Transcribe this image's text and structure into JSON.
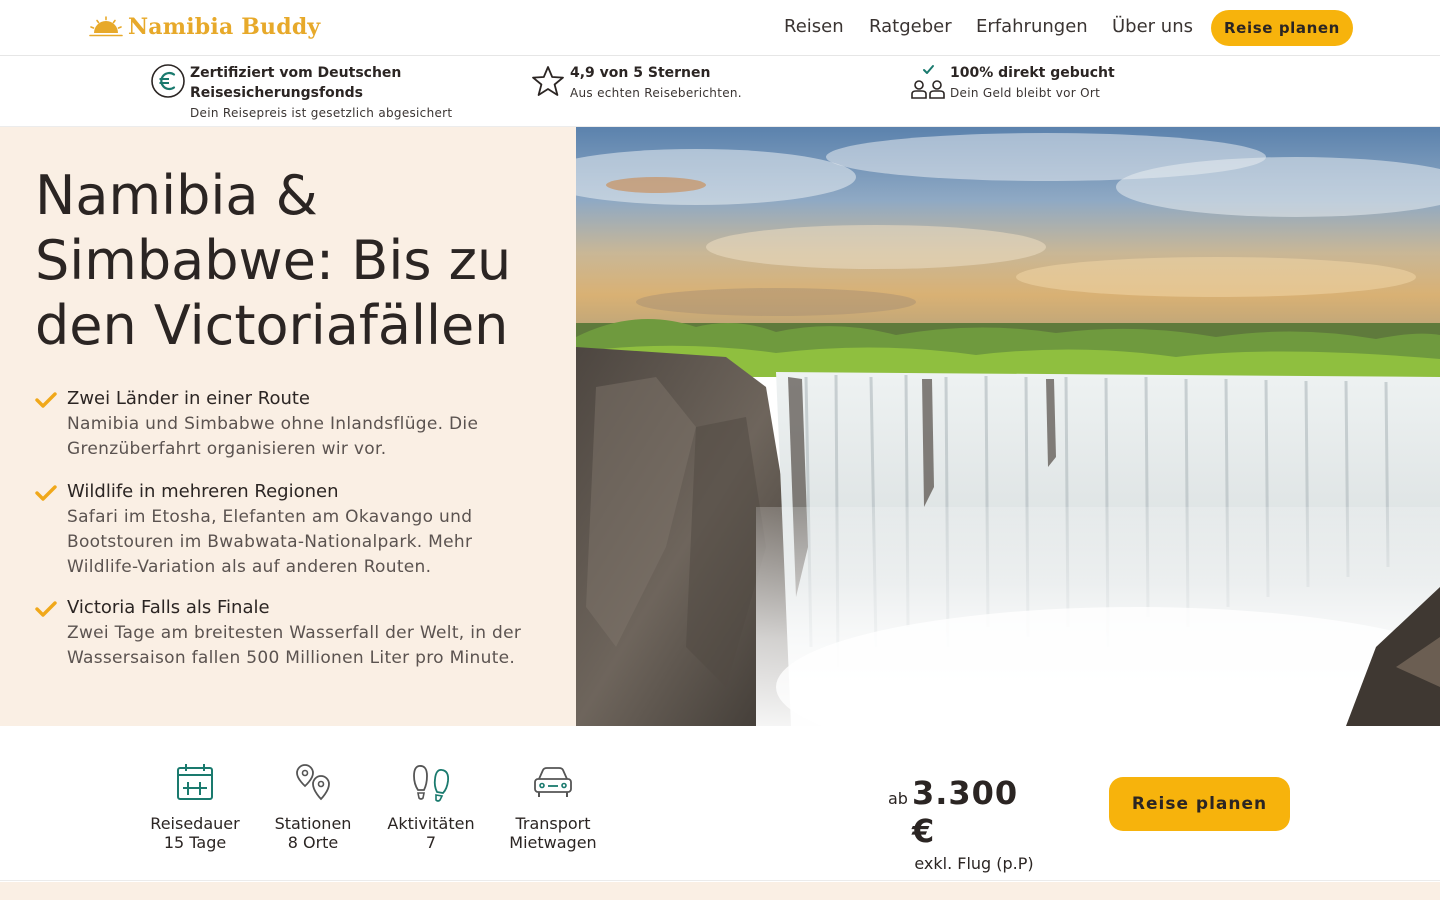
{
  "brand": {
    "name": "Namibia Buddy",
    "color": "#e7a92a"
  },
  "nav": {
    "items": [
      "Reisen",
      "Ratgeber",
      "Erfahrungen",
      "Über uns"
    ],
    "cta": "Reise planen"
  },
  "trust": [
    {
      "icon": "euro-icon",
      "title": "Zertifiziert vom Deutschen Reisesicherungsfonds",
      "sub": "Dein Reisepreis ist gesetzlich abgesichert"
    },
    {
      "icon": "star-icon",
      "title": "4,9 von 5 Sternen",
      "sub": "Aus echten Reiseberichten."
    },
    {
      "icon": "people-check-icon",
      "title": "100% direkt gebucht",
      "sub": "Dein Geld bleibt vor Ort"
    }
  ],
  "hero": {
    "title": "Namibia & Simbabwe: Bis zu den Victoriafällen",
    "features": [
      {
        "title": "Zwei Länder in einer Route",
        "desc": "Namibia und Simbabwe ohne Inlandsflüge. Die Grenzüberfahrt organisieren wir vor."
      },
      {
        "title": "Wildlife in mehreren Regionen",
        "desc": "Safari im Etosha, Elefanten am Okavango und Bootstouren im Bwabwata-Nationalpark. Mehr Wildlife-Variation als auf anderen Routen."
      },
      {
        "title": "Victoria Falls als Finale",
        "desc": "Zwei Tage am breitesten Wasserfall der Welt, in der Wassersaison fallen 500 Millionen Liter pro Minute."
      }
    ],
    "image": "victoria-falls-photo"
  },
  "stats": [
    {
      "icon": "calendar-icon",
      "label": "Reisedauer",
      "value": "15 Tage"
    },
    {
      "icon": "map-pin-icon",
      "label": "Stationen",
      "value": "8 Orte"
    },
    {
      "icon": "footprints-icon",
      "label": "Aktivitäten",
      "value": "7"
    },
    {
      "icon": "car-icon",
      "label": "Transport",
      "value": "Mietwagen"
    }
  ],
  "price": {
    "prefix": "ab",
    "amount": "3.300 €",
    "note": "exkl. Flug (p.P)"
  },
  "cta_main": "Reise planen",
  "colors": {
    "accent": "#f7b30c",
    "cream": "#faefe4",
    "teal": "#1a7a6e",
    "text": "#2b2523"
  }
}
